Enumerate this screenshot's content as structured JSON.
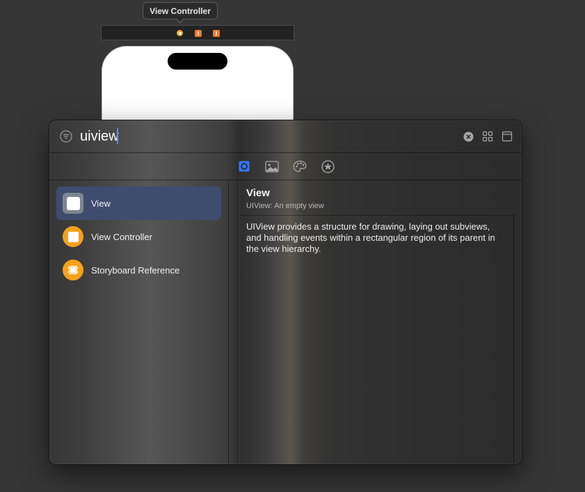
{
  "scene": {
    "tooltip": "View Controller"
  },
  "library": {
    "search": {
      "value": "uiview",
      "placeholder": ""
    },
    "tabs": [
      {
        "name": "objects-library",
        "icon": "object-cube-icon",
        "active": true
      },
      {
        "name": "media-library",
        "icon": "photo-icon",
        "active": false
      },
      {
        "name": "color-library",
        "icon": "palette-icon",
        "active": false
      },
      {
        "name": "favorites-library",
        "icon": "star-icon",
        "active": false
      }
    ],
    "items": [
      {
        "label": "View",
        "icon": "view-icon",
        "selected": true
      },
      {
        "label": "View Controller",
        "icon": "view-controller-icon",
        "selected": false
      },
      {
        "label": "Storyboard Reference",
        "icon": "storyboard-reference-icon",
        "selected": false
      }
    ],
    "detail": {
      "title": "View",
      "subtitle": "UIView: An empty view",
      "body": "UIView provides a structure for drawing, laying out subviews, and handling events within a rectangular region of its parent in the view hierarchy."
    }
  },
  "colors": {
    "accent": "#3e4d6e",
    "object_orange": "#f5a11a",
    "caret_blue": "#4f8ff7"
  }
}
